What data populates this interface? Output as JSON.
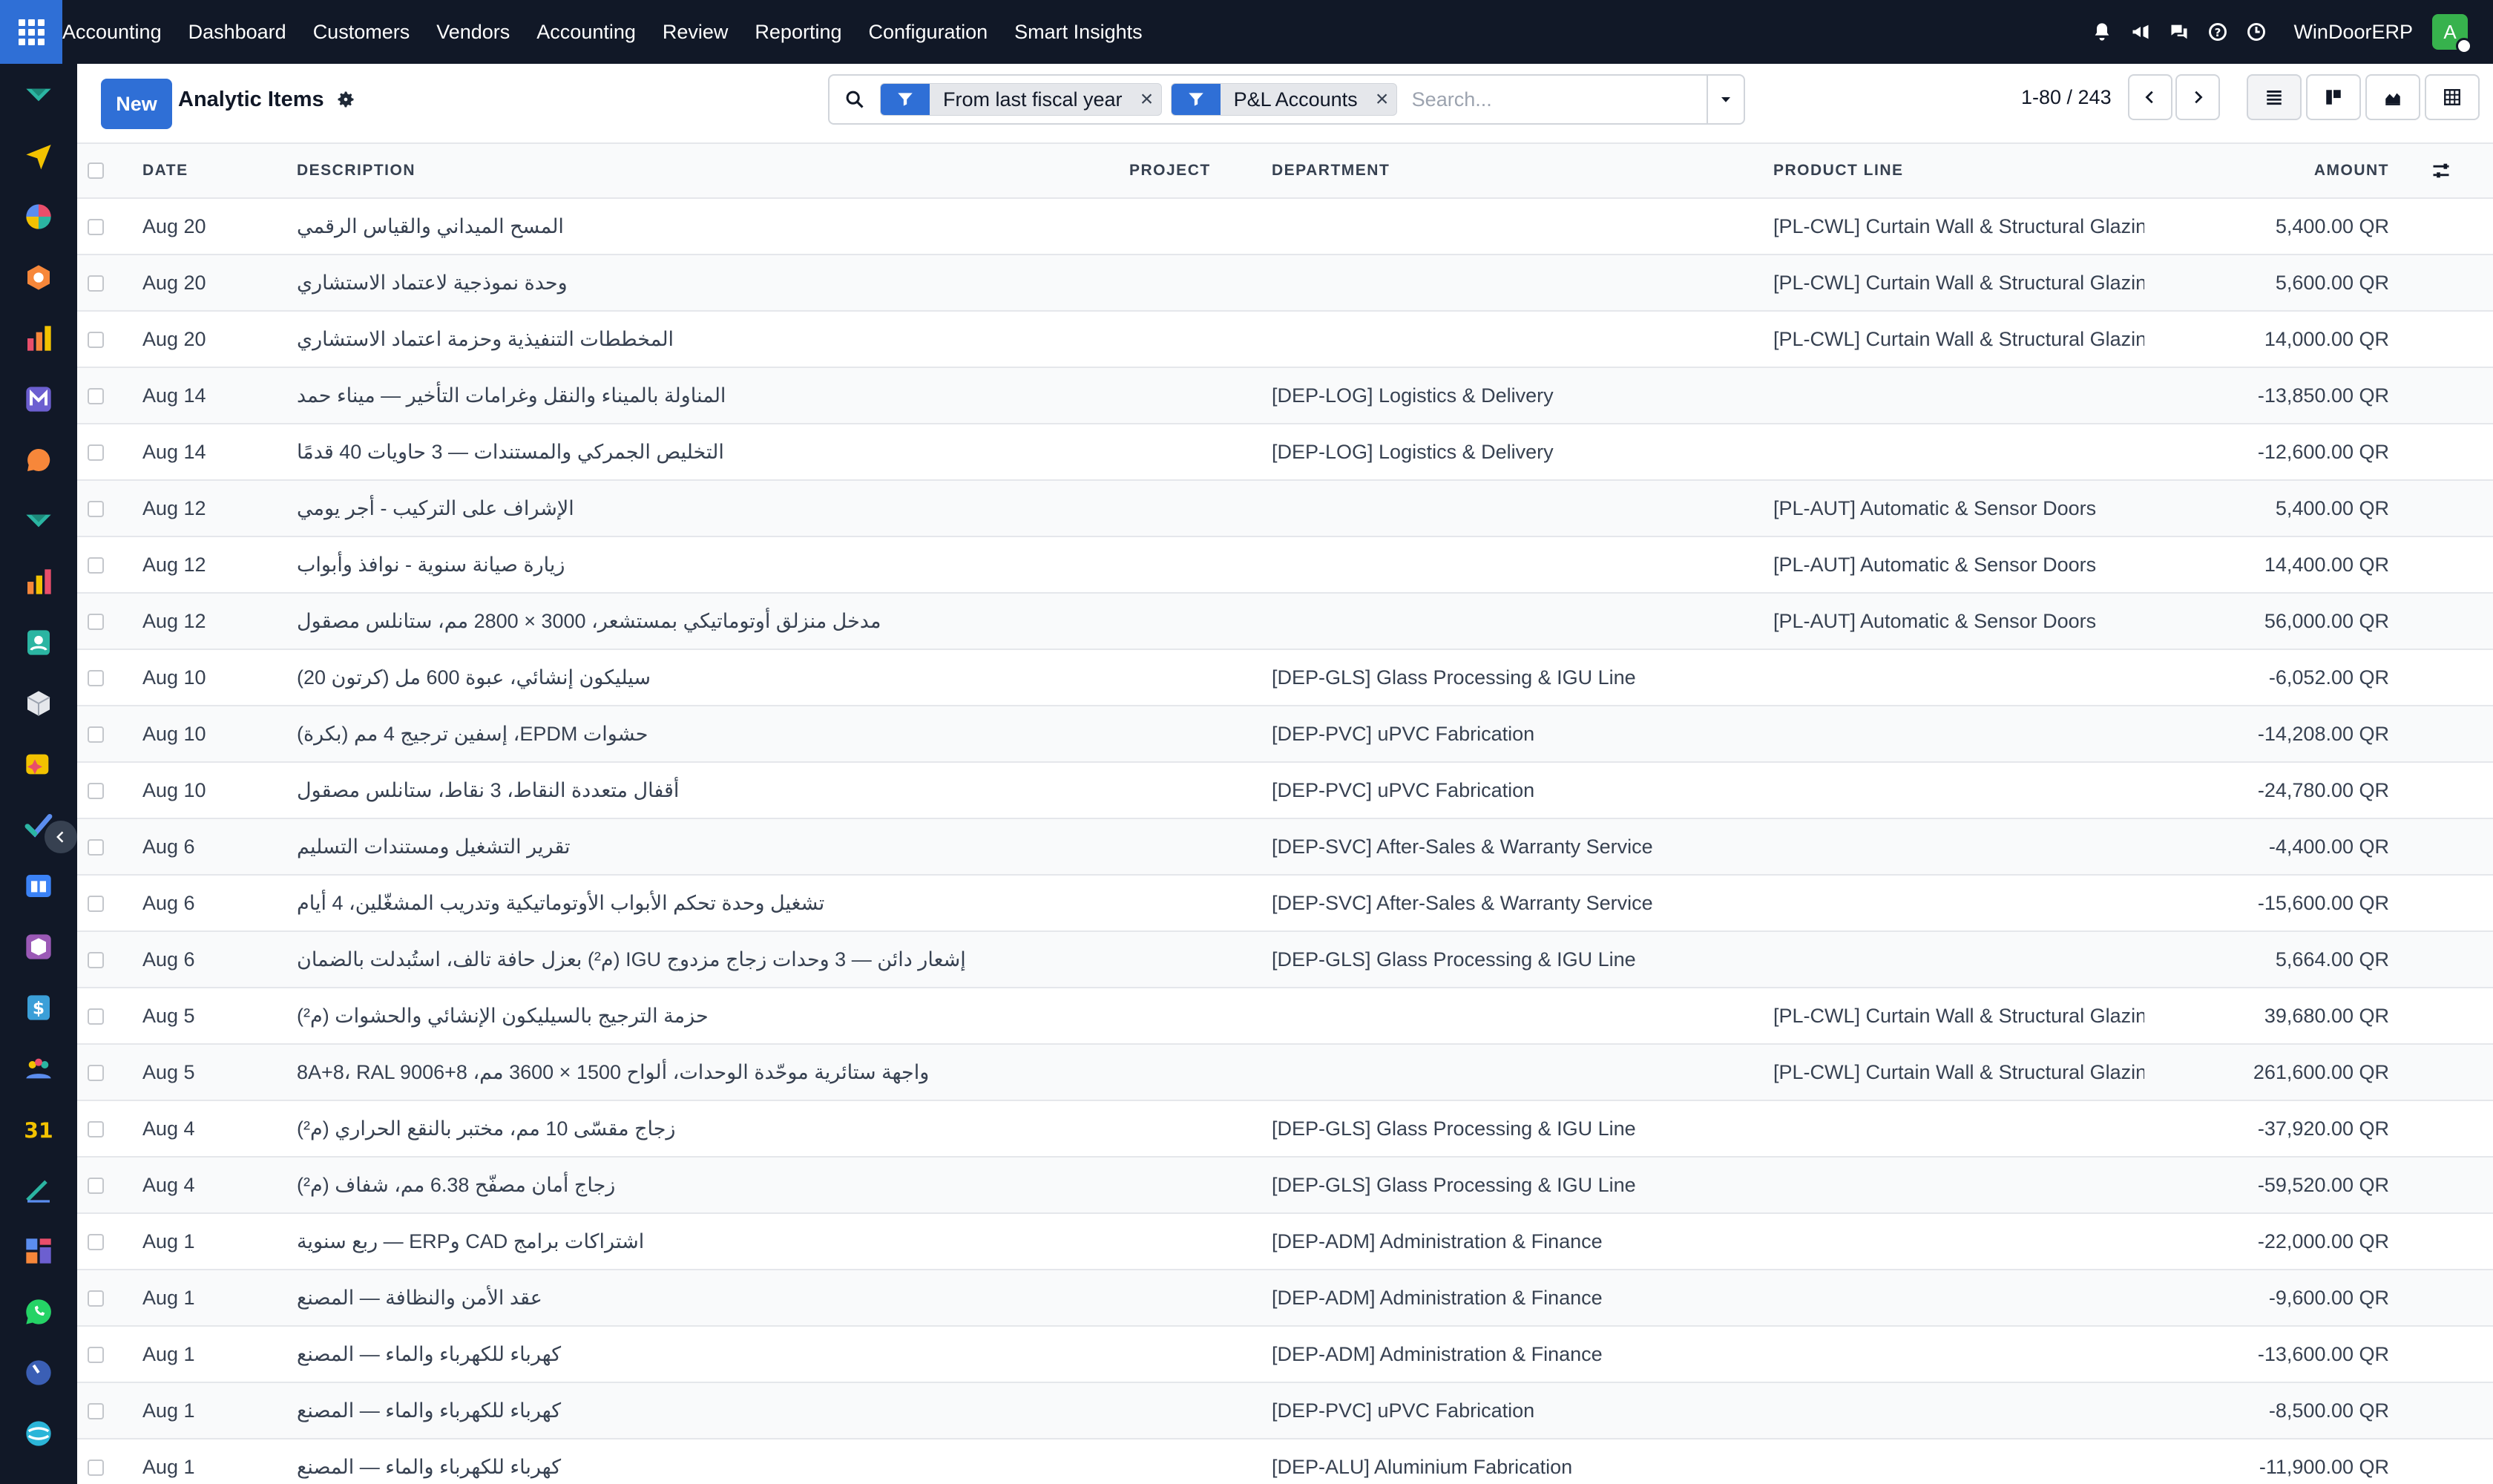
{
  "navbar": {
    "brand": "Accounting",
    "menu": [
      "Dashboard",
      "Customers",
      "Vendors",
      "Accounting",
      "Review",
      "Reporting",
      "Configuration",
      "Smart Insights"
    ],
    "company": "WinDoorERP",
    "avatar_letter": "A"
  },
  "sidebar": {
    "icons": [
      "vendor-bill-icon",
      "send-icon",
      "pie-chart-icon",
      "cube-icon",
      "bar-chart-icon",
      "mail-app-icon",
      "chat-bubble-icon",
      "vendor-bill-icon",
      "bar-chart-icon",
      "contact-card-icon",
      "box-icon",
      "sparkle-icon",
      "check-icon",
      "book-icon",
      "package-icon",
      "dollar-icon",
      "people-icon",
      "calendar-31-icon",
      "sign-icon",
      "dashboard-icon",
      "whatsapp-icon",
      "timer-icon",
      "swirl-icon"
    ]
  },
  "control": {
    "new_label": "New",
    "title": "Analytic Items",
    "facets": [
      {
        "label": "From last fiscal year"
      },
      {
        "label": "P&L Accounts"
      }
    ],
    "search_placeholder": "Search...",
    "pager": "1-80 / 243"
  },
  "table": {
    "columns": {
      "date": "Date",
      "description": "Description",
      "project": "Project",
      "department": "Department",
      "product_line": "Product Line",
      "amount": "Amount"
    },
    "rows": [
      {
        "date": "Aug 20",
        "description": "المسح الميداني والقياس الرقمي",
        "project": "",
        "department": "",
        "product_line": "[PL-CWL] Curtain Wall & Structural Glazing",
        "amount": "5,400.00 QR"
      },
      {
        "date": "Aug 20",
        "description": "وحدة نموذجية لاعتماد الاستشاري",
        "project": "",
        "department": "",
        "product_line": "[PL-CWL] Curtain Wall & Structural Glazing",
        "amount": "5,600.00 QR"
      },
      {
        "date": "Aug 20",
        "description": "المخططات التنفيذية وحزمة اعتماد الاستشاري",
        "project": "",
        "department": "",
        "product_line": "[PL-CWL] Curtain Wall & Structural Glazing",
        "amount": "14,000.00 QR"
      },
      {
        "date": "Aug 14",
        "description": "المناولة بالميناء والنقل وغرامات التأخير — ميناء حمد",
        "project": "",
        "department": "[DEP-LOG] Logistics & Delivery",
        "product_line": "",
        "amount": "-13,850.00 QR"
      },
      {
        "date": "Aug 14",
        "description": "التخليص الجمركي والمستندات — 3 حاويات 40 قدمًا",
        "project": "",
        "department": "[DEP-LOG] Logistics & Delivery",
        "product_line": "",
        "amount": "-12,600.00 QR"
      },
      {
        "date": "Aug 12",
        "description": "الإشراف على التركيب - أجر يومي",
        "project": "",
        "department": "",
        "product_line": "[PL-AUT] Automatic & Sensor Doors",
        "amount": "5,400.00 QR"
      },
      {
        "date": "Aug 12",
        "description": "زيارة صيانة سنوية - نوافذ وأبواب",
        "project": "",
        "department": "",
        "product_line": "[PL-AUT] Automatic & Sensor Doors",
        "amount": "14,400.00 QR"
      },
      {
        "date": "Aug 12",
        "description": "مدخل منزلق أوتوماتيكي بمستشعر، 3000 × 2800 مم، ستانلس مصقول",
        "project": "",
        "department": "",
        "product_line": "[PL-AUT] Automatic & Sensor Doors",
        "amount": "56,000.00 QR"
      },
      {
        "date": "Aug 10",
        "description": "سيليكون إنشائي، عبوة 600 مل (كرتون 20)",
        "project": "",
        "department": "[DEP-GLS] Glass Processing & IGU Line",
        "product_line": "",
        "amount": "-6,052.00 QR"
      },
      {
        "date": "Aug 10",
        "description": "حشوات EPDM، إسفين ترجيج 4 مم (بكرة)",
        "project": "",
        "department": "[DEP-PVC] uPVC Fabrication",
        "product_line": "",
        "amount": "-14,208.00 QR"
      },
      {
        "date": "Aug 10",
        "description": "أقفال متعددة النقاط، 3 نقاط، ستانلس مصقول",
        "project": "",
        "department": "[DEP-PVC] uPVC Fabrication",
        "product_line": "",
        "amount": "-24,780.00 QR"
      },
      {
        "date": "Aug 6",
        "description": "تقرير التشغيل ومستندات التسليم",
        "project": "",
        "department": "[DEP-SVC] After-Sales & Warranty Service",
        "product_line": "",
        "amount": "-4,400.00 QR"
      },
      {
        "date": "Aug 6",
        "description": "تشغيل وحدة تحكم الأبواب الأوتوماتيكية وتدريب المشغّلين، 4 أيام",
        "project": "",
        "department": "[DEP-SVC] After-Sales & Warranty Service",
        "product_line": "",
        "amount": "-15,600.00 QR"
      },
      {
        "date": "Aug 6",
        "description": "إشعار دائن — 3 وحدات زجاج مزدوج IGU (م²) بعزل حافة تالف، استُبدلت بالضمان",
        "project": "",
        "department": "[DEP-GLS] Glass Processing & IGU Line",
        "product_line": "",
        "amount": "5,664.00 QR"
      },
      {
        "date": "Aug 5",
        "description": "حزمة الترجيج بالسيليكون الإنشائي والحشوات (م²)",
        "project": "",
        "department": "",
        "product_line": "[PL-CWL] Curtain Wall & Structural Glazing",
        "amount": "39,680.00 QR"
      },
      {
        "date": "Aug 5",
        "description": "واجهة ستائرية موحّدة الوحدات، ألواح 1500 × 3600 مم، 8+8A+8، RAL 9006",
        "project": "",
        "department": "",
        "product_line": "[PL-CWL] Curtain Wall & Structural Glazing",
        "amount": "261,600.00 QR"
      },
      {
        "date": "Aug 4",
        "description": "زجاج مقسّى 10 مم، مختبر بالنقع الحراري (م²)",
        "project": "",
        "department": "[DEP-GLS] Glass Processing & IGU Line",
        "product_line": "",
        "amount": "-37,920.00 QR"
      },
      {
        "date": "Aug 4",
        "description": "زجاج أمان مصفّح 6.38 مم، شفاف (م²)",
        "project": "",
        "department": "[DEP-GLS] Glass Processing & IGU Line",
        "product_line": "",
        "amount": "-59,520.00 QR"
      },
      {
        "date": "Aug 1",
        "description": "اشتراكات برامج CAD وERP — ربع سنوية",
        "project": "",
        "department": "[DEP-ADM] Administration & Finance",
        "product_line": "",
        "amount": "-22,000.00 QR"
      },
      {
        "date": "Aug 1",
        "description": "عقد الأمن والنظافة — المصنع",
        "project": "",
        "department": "[DEP-ADM] Administration & Finance",
        "product_line": "",
        "amount": "-9,600.00 QR"
      },
      {
        "date": "Aug 1",
        "description": "كهرباء للكهرباء والماء — المصنع",
        "project": "",
        "department": "[DEP-ADM] Administration & Finance",
        "product_line": "",
        "amount": "-13,600.00 QR"
      },
      {
        "date": "Aug 1",
        "description": "كهرباء للكهرباء والماء — المصنع",
        "project": "",
        "department": "[DEP-PVC] uPVC Fabrication",
        "product_line": "",
        "amount": "-8,500.00 QR"
      },
      {
        "date": "Aug 1",
        "description": "كهرباء للكهرباء والماء — المصنع",
        "project": "",
        "department": "[DEP-ALU] Aluminium Fabrication",
        "product_line": "",
        "amount": "-11,900.00 QR"
      }
    ]
  },
  "colors": {
    "navbar_bg": "#111827",
    "primary": "#2f6fd6",
    "avatar_bg": "#37b24d"
  }
}
